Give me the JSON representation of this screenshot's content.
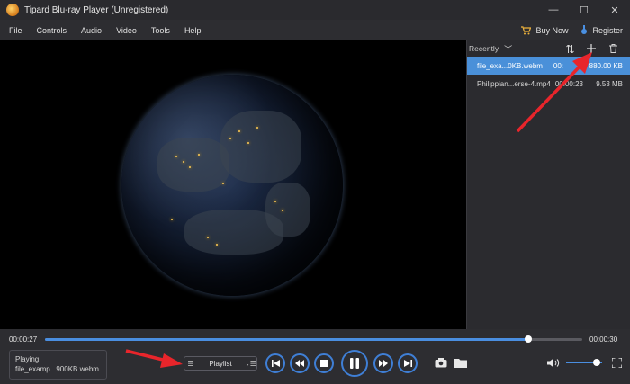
{
  "window": {
    "title": "Tipard Blu-ray Player (Unregistered)",
    "controls": [
      "—",
      "☐",
      "✕"
    ]
  },
  "menu": {
    "items": [
      "File",
      "Controls",
      "Audio",
      "Video",
      "Tools",
      "Help"
    ],
    "buy_now": "Buy Now",
    "register": "Register"
  },
  "playlist": {
    "header": "Recently",
    "items": [
      {
        "name": "file_exa...0KB.webm",
        "duration": "00:",
        "size": "880.00 KB",
        "selected": true
      },
      {
        "name": "Philippian...erse-4.mp4",
        "duration": "00:00:23",
        "size": "9.53 MB",
        "selected": false
      }
    ]
  },
  "player": {
    "current_time": "00:00:27",
    "total_time": "00:00:30",
    "progress": 0.9,
    "volume": 0.85,
    "now_playing_label": "Playing:",
    "now_playing_file": "file_examp...900KB.webm",
    "playlist_button": "Playlist"
  },
  "colors": {
    "accent": "#4a90d9",
    "annotation_arrow": "#e8252b"
  },
  "icons": [
    "app-logo-icon",
    "cart-icon",
    "register-key-icon",
    "sort-icon",
    "add-icon",
    "trash-icon",
    "prev-track-icon",
    "rewind-icon",
    "stop-icon",
    "pause-icon",
    "fast-forward-icon",
    "next-track-icon",
    "snapshot-icon",
    "folder-icon",
    "volume-icon",
    "fullscreen-icon"
  ]
}
